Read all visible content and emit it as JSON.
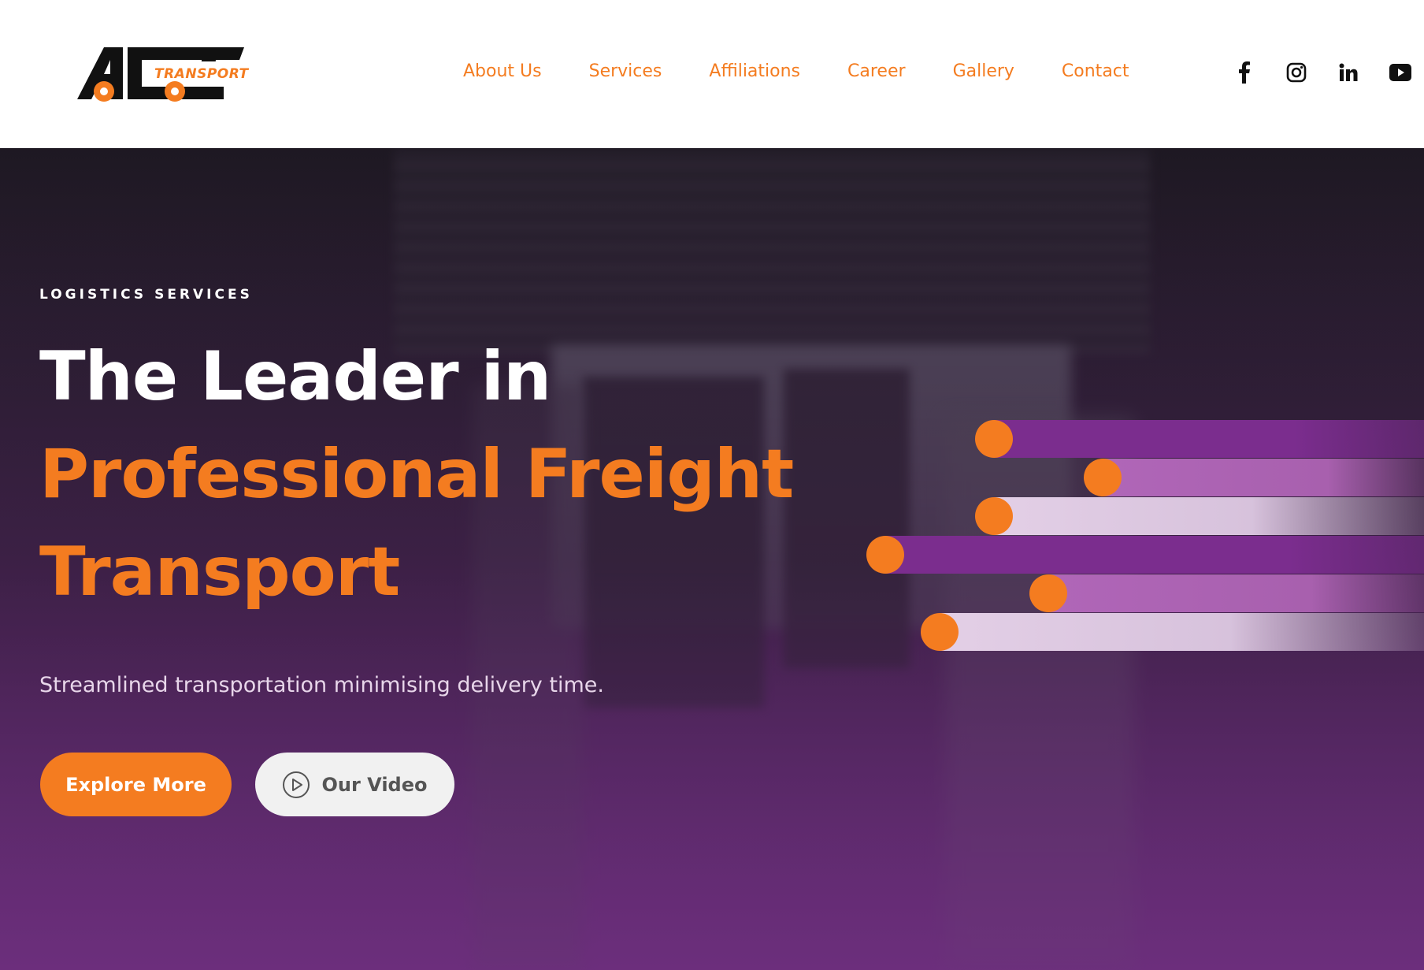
{
  "brand": {
    "logo_text": "TRANSPORT",
    "logo_letters": "ACT",
    "accent_color": "#f47c20",
    "hero_purple": "#7b2d8e"
  },
  "nav": {
    "items": [
      {
        "label": "About Us"
      },
      {
        "label": "Services"
      },
      {
        "label": "Affiliations"
      },
      {
        "label": "Career"
      },
      {
        "label": "Gallery"
      },
      {
        "label": "Contact"
      }
    ]
  },
  "social": {
    "icons": [
      "facebook-icon",
      "instagram-icon",
      "linkedin-icon",
      "youtube-icon"
    ]
  },
  "hero": {
    "eyebrow": "LOGISTICS SERVICES",
    "headline_line1": "The Leader in",
    "headline_line2": "Professional Freight",
    "headline_line3": "Transport",
    "subtitle": "Streamlined transportation minimising delivery time.",
    "primary_button": "Explore More",
    "secondary_button": "Our Video"
  }
}
